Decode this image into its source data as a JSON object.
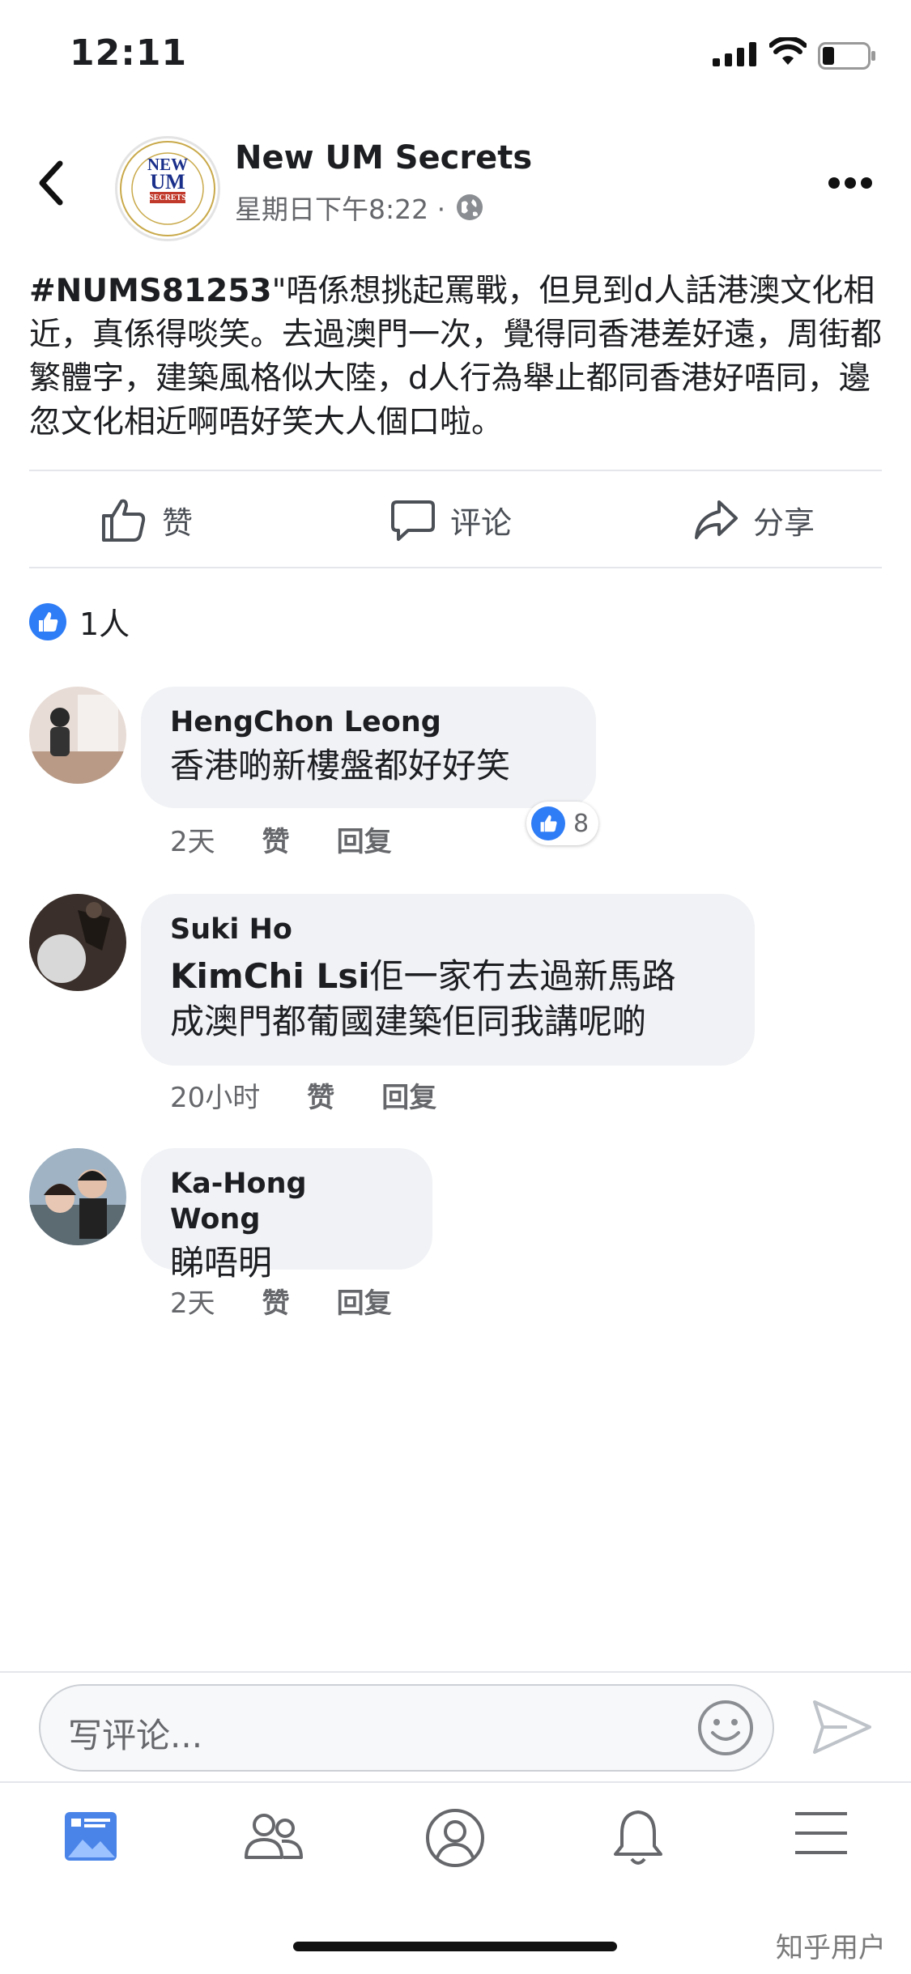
{
  "status_bar": {
    "time": "12:11"
  },
  "post": {
    "page_name": "New UM Secrets",
    "timestamp": "星期日下午8:22 ·",
    "logo": {
      "top_text": "UNIVERSIDADE DE MACAU",
      "line1": "NEW",
      "line2": "UM",
      "line3": "SECRETS",
      "bottom_text": "澳門大學"
    },
    "hashtag": "#NUMS81253",
    "body": "\"唔係想挑起罵戰，但見到d人話港澳文化相近，真係得啖笑。去過澳門一次，覺得同香港差好遠，周街都繁體字，建築風格似大陸，d人行為舉止都同香港好唔同，邊忽文化相近啊唔好笑大人個口啦。"
  },
  "actions": {
    "like": "赞",
    "comment": "评论",
    "share": "分享"
  },
  "reactions": {
    "count_text": "1人"
  },
  "comments": [
    {
      "name": "HengChon Leong",
      "text": "香港啲新樓盤都好好笑",
      "time": "2天",
      "like": "赞",
      "reply": "回复",
      "likes": "8"
    },
    {
      "name": "Suki Ho",
      "mention": "KimChi Lsi",
      "text_line1": "佢一家冇去過新馬路",
      "text_line2": "成澳門都葡國建築佢同我講呢啲",
      "time": "20小时",
      "like": "赞",
      "reply": "回复"
    },
    {
      "name": "Ka-Hong Wong",
      "text": "睇唔明",
      "time": "2天",
      "like": "赞",
      "reply": "回复"
    }
  ],
  "composer": {
    "placeholder": "写评论..."
  },
  "tabbar": {
    "icons": [
      "news-feed-icon",
      "friends-icon",
      "profile-icon",
      "notifications-icon",
      "menu-icon"
    ]
  },
  "watermark": "知乎用户",
  "colors": {
    "accent": "#2e7cf6",
    "bubble": "#f0f2f5",
    "secondary_text": "#65676b"
  }
}
